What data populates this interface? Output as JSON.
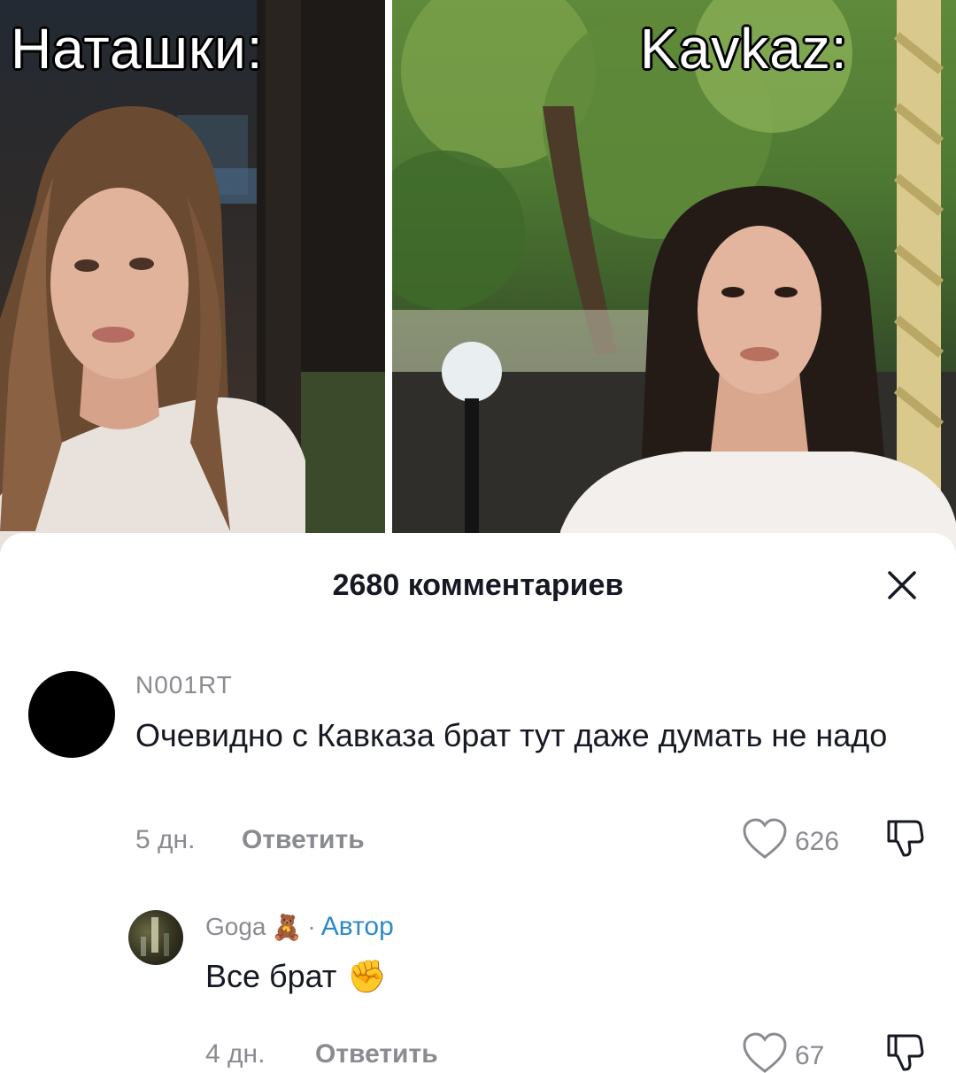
{
  "meme": {
    "left_caption": "Наташки:",
    "right_caption": "Kavkaz:"
  },
  "comments_sheet": {
    "title": "2680 комментариев",
    "close_icon": "close-icon",
    "comments": [
      {
        "username": "N001RT",
        "text": "Очевидно с Кавказа брат тут даже думать не надо",
        "time": "5 дн.",
        "reply_label": "Ответить",
        "likes": "626"
      },
      {
        "username": "Goga",
        "username_emoji": "🧸",
        "separator": "·",
        "author_label": "Автор",
        "text": "Все брат",
        "text_emoji": "✊",
        "time": "4 дн.",
        "reply_label": "Ответить",
        "likes": "67"
      }
    ]
  },
  "colors": {
    "text_primary": "#161823",
    "text_secondary": "#8a8b91",
    "author_accent": "#2e8ac6"
  }
}
